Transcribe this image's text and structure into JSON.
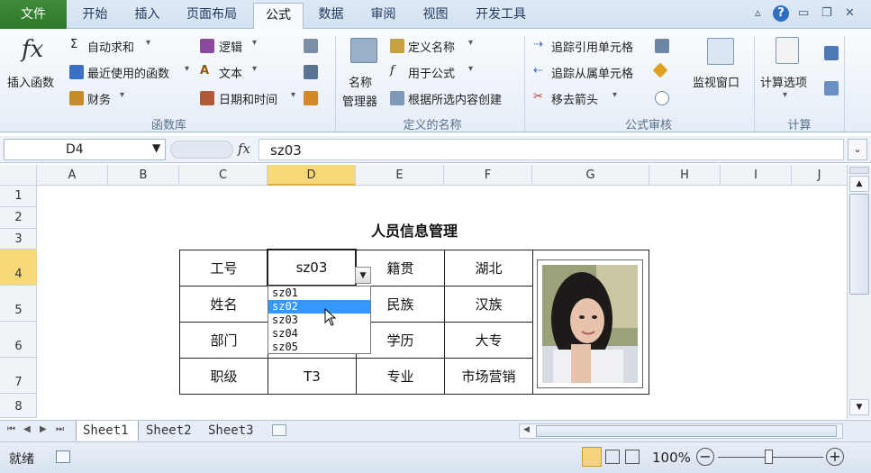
{
  "ribbon": {
    "tabs": [
      "文件",
      "开始",
      "插入",
      "页面布局",
      "公式",
      "数据",
      "审阅",
      "视图",
      "开发工具"
    ],
    "active_tab": "公式",
    "insert_function": "插入函数",
    "autosum": "自动求和",
    "recent": "最近使用的函数",
    "finance": "财务",
    "logic": "逻辑",
    "text": "文本",
    "datetime": "日期和时间",
    "group_lib": "函数库",
    "name_mgr_1": "名称",
    "name_mgr_2": "管理器",
    "define_name": "定义名称",
    "use_in_formula": "用于公式",
    "create_from_sel": "根据所选内容创建",
    "group_names": "定义的名称",
    "trace_prec": "追踪引用单元格",
    "trace_dep": "追踪从属单元格",
    "remove_arrows": "移去箭头",
    "watch_window": "监视窗口",
    "group_audit": "公式审核",
    "calc_options": "计算选项",
    "group_calc": "计算"
  },
  "formula_bar": {
    "name_box": "D4",
    "fx": "fx",
    "value": "sz03"
  },
  "columns": [
    "A",
    "B",
    "C",
    "D",
    "E",
    "F",
    "G",
    "H",
    "I",
    "J"
  ],
  "rows": [
    "1",
    "2",
    "3",
    "4",
    "5",
    "6",
    "7",
    "8"
  ],
  "sheet": {
    "title": "人员信息管理",
    "labels": {
      "id": "工号",
      "name": "姓名",
      "dept": "部门",
      "level": "职级",
      "hometown": "籍贯",
      "ethnic": "民族",
      "edu": "学历",
      "major": "专业"
    },
    "values": {
      "id": "sz03",
      "level": "T3",
      "hometown": "湖北",
      "ethnic": "汉族",
      "edu": "大专",
      "major": "市场营销"
    }
  },
  "dropdown": {
    "options": [
      "sz01",
      "sz02",
      "sz03",
      "sz04",
      "sz05"
    ],
    "highlighted_index": 1
  },
  "sheet_tabs": [
    "Sheet1",
    "Sheet2",
    "Sheet3"
  ],
  "status": {
    "ready": "就绪",
    "zoom": "100%"
  }
}
